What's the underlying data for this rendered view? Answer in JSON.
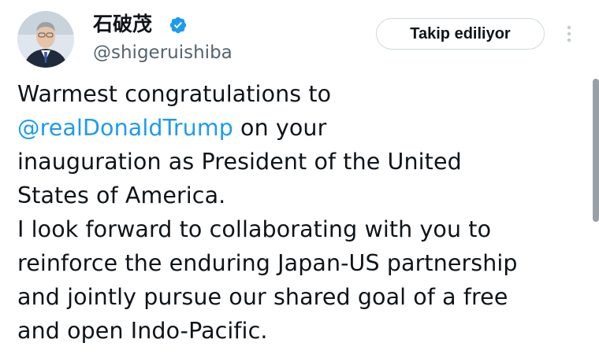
{
  "author": {
    "display_name": "石破茂",
    "handle": "@shigeruishiba",
    "verified": true
  },
  "actions": {
    "follow_label": "Takip ediliyor"
  },
  "icons": {
    "verified": "verified-badge-icon",
    "more": "more-vertical-icon"
  },
  "colors": {
    "mention": "#1d9bf0",
    "verified": "#1d9bf0",
    "secondary_text": "#536471"
  },
  "tweet": {
    "line1": "Warmest congratulations to",
    "mention": "@realDonaldTrump",
    "line2_rest": " on your",
    "line3": "inauguration as President of the United",
    "line4": "States of America.",
    "line5": "I look forward to collaborating with you to",
    "line6": "reinforce the enduring Japan-US partnership",
    "line7": "and jointly pursue our shared goal of a free",
    "line8": "and open Indo-Pacific."
  }
}
